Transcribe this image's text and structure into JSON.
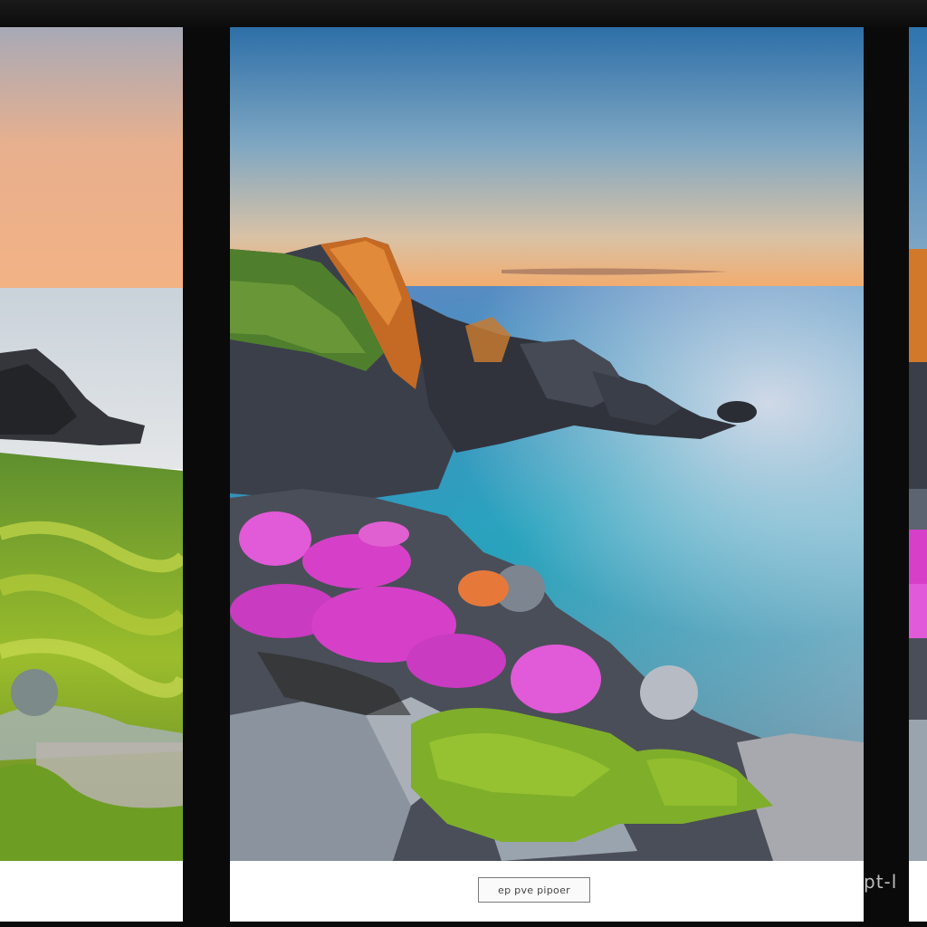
{
  "caption": {
    "button_label": "ep pve pipoer",
    "edge_text": "pt-l"
  },
  "colors": {
    "frame": "#0a0a0a",
    "caption_background": "#ffffff",
    "sky_top": "#2f78b0",
    "sunset": "#f0b178",
    "sea": "#2aa9c0",
    "flowers": "#d640c8",
    "moss": "#7fae2a",
    "rock": "#4a4e58"
  },
  "icons": {
    "left_photo": "coastal-sunset-grassland-image",
    "center_photo": "coastal-cliff-flowers-image",
    "right_photo": "coastal-cliff-partial-image"
  }
}
